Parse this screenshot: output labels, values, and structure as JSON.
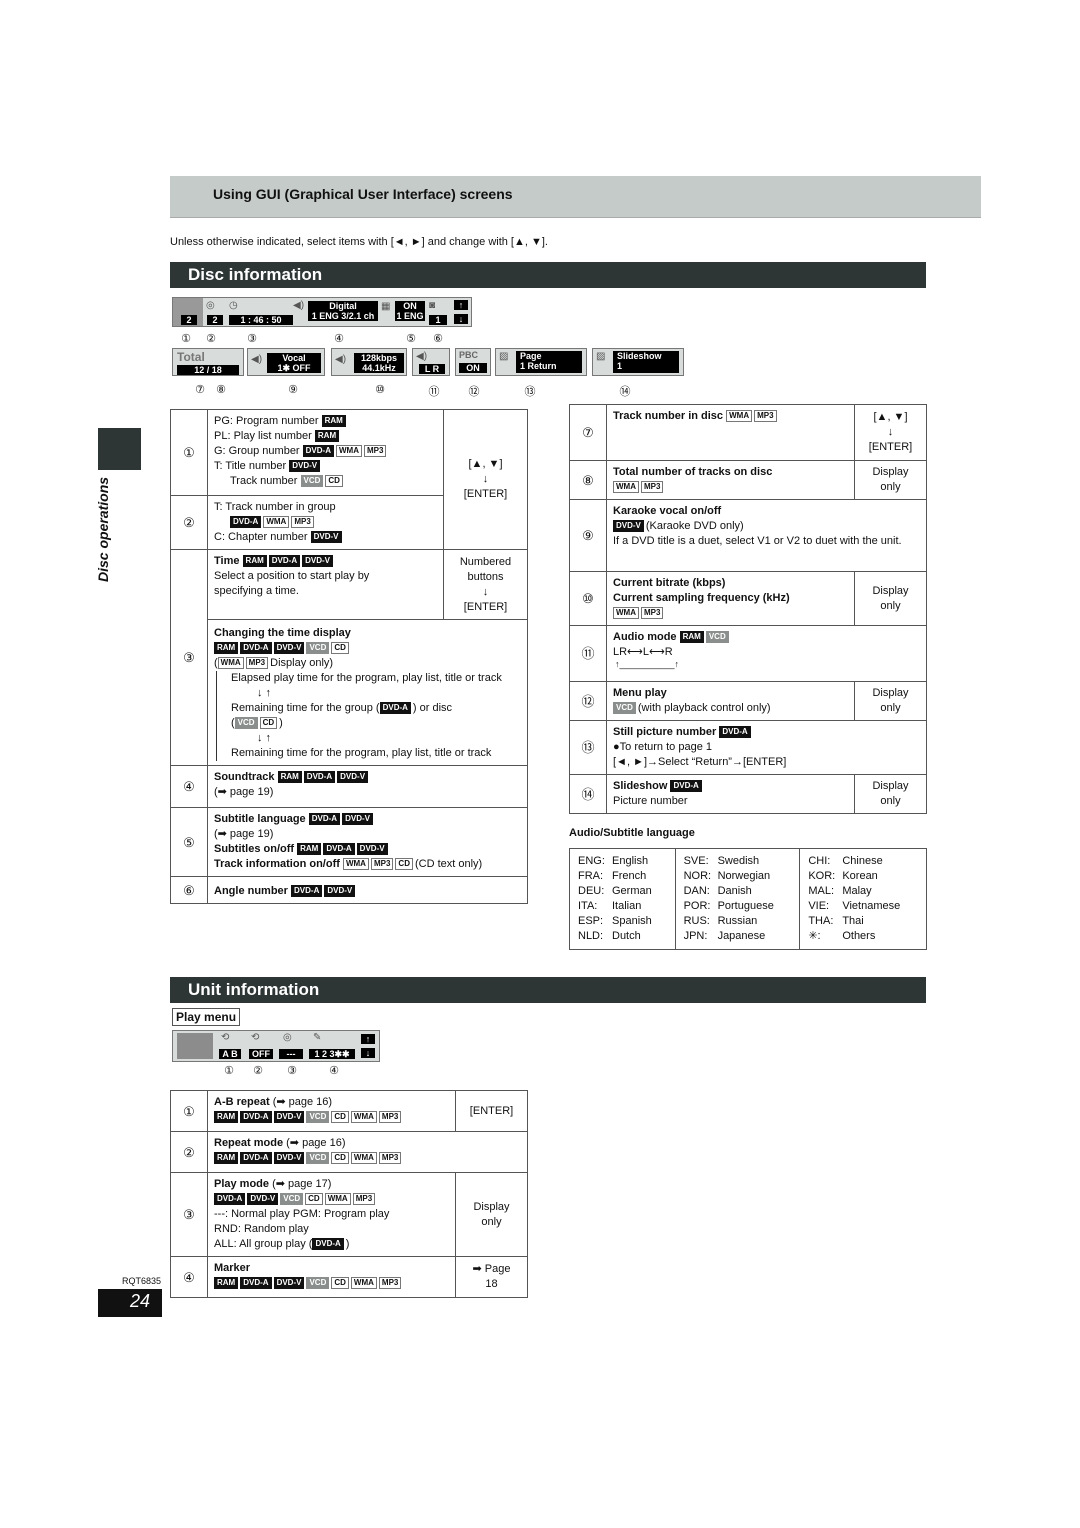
{
  "gui_header": "Using GUI (Graphical User Interface) screens",
  "intro": "Unless otherwise indicated, select items with [◄, ►] and change with [▲, ▼].",
  "side_label": "Disc operations",
  "disc_info": {
    "title": "Disc information",
    "osd_row1": {
      "program_number": "2",
      "group_number": "2",
      "time": "1 : 46 : 50",
      "audio_line1": "Digital",
      "audio_line2": "1 ENG 3/2.1 ch",
      "subtitle_line1": "ON",
      "subtitle_line2": "1 ENG",
      "angle": "1",
      "callouts": [
        "①",
        "②",
        "③",
        "④",
        "⑤",
        "⑥"
      ]
    },
    "osd_row2": {
      "total_label": "Total",
      "total_value": "12 / 18",
      "vocal_line1": "Vocal",
      "vocal_line2": "1✱   OFF",
      "bitrate_line1": "128kbps",
      "bitrate_line2": "44.1kHz",
      "audio_mode": "L R",
      "pbc_label": "PBC",
      "pbc_value": "ON",
      "page_line1": "Page",
      "page_line2": "1  Return",
      "slideshow_line1": "Slideshow",
      "slideshow_line2": "1",
      "callouts": [
        "⑦",
        "⑧",
        "⑨",
        "⑩",
        "⑪",
        "⑫",
        "⑬",
        "⑭"
      ]
    },
    "left_table": {
      "r1": {
        "n": "①",
        "pg": "PG:  Program number",
        "pl": "PL:  Play list number",
        "g": "G:  Group number",
        "t": "T:  Title number",
        "track": "Track number"
      },
      "r12_action": [
        "[▲, ▼]",
        "↓",
        "[ENTER]"
      ],
      "r2": {
        "n": "②",
        "t": "T:  Track number in group",
        "c": "C:  Chapter number"
      },
      "r3a": {
        "n": "③",
        "title": "Time",
        "desc": "Select a position to start play by specifying a time.",
        "action": [
          "Numbered",
          "buttons",
          "↓",
          "[ENTER]"
        ]
      },
      "r3b": {
        "title": "Changing the time display",
        "display_only": "Display only)",
        "l1": "Elapsed play time for the program, play list, title or track",
        "arrows": "↓ ↑",
        "l2a": "Remaining time for the group (",
        "l2b": ") or disc",
        "l3": "Remaining time for the program, play list, title or track"
      },
      "r4": {
        "n": "④",
        "title": "Soundtrack",
        "ref": "(➡ page 19)"
      },
      "r5": {
        "n": "⑤",
        "title1": "Subtitle language",
        "ref": "(➡ page 19)",
        "title2": "Subtitles on/off",
        "title3": "Track information on/off",
        "note": "(CD text only)"
      },
      "r6": {
        "n": "⑥",
        "title": "Angle number"
      }
    },
    "right_table": {
      "r7": {
        "n": "⑦",
        "title": "Track number in disc",
        "action": [
          "[▲, ▼]",
          "↓",
          "[ENTER]"
        ]
      },
      "r8": {
        "n": "⑧",
        "title": "Total number of tracks on disc",
        "action": [
          "Display",
          "only"
        ]
      },
      "r9": {
        "n": "⑨",
        "title": "Karaoke vocal on/off",
        "note": "(Karaoke DVD only)",
        "desc": "If a DVD title is a duet, select V1 or V2 to duet with the unit."
      },
      "r10": {
        "n": "⑩",
        "title1": "Current bitrate (kbps)",
        "title2": "Current sampling frequency (kHz)",
        "action": [
          "Display",
          "only"
        ]
      },
      "r11": {
        "n": "⑪",
        "title": "Audio mode",
        "flow": "LR⟷L⟷R",
        "loop": "↑___________↑"
      },
      "r12": {
        "n": "⑫",
        "title": "Menu play",
        "note": "(with playback control only)",
        "action": [
          "Display",
          "only"
        ]
      },
      "r13": {
        "n": "⑬",
        "title": "Still picture number",
        "bullet": "●To return to page 1",
        "instr": "[◄, ►]→Select “Return”→[ENTER]"
      },
      "r14": {
        "n": "⑭",
        "title": "Slideshow",
        "desc": "Picture number",
        "action": [
          "Display",
          "only"
        ]
      }
    },
    "lang_title": "Audio/Subtitle language",
    "languages": [
      [
        [
          "ENG:",
          "English"
        ],
        [
          "FRA:",
          "French"
        ],
        [
          "DEU:",
          "German"
        ],
        [
          "ITA:",
          "Italian"
        ],
        [
          "ESP:",
          "Spanish"
        ],
        [
          "NLD:",
          "Dutch"
        ]
      ],
      [
        [
          "SVE:",
          "Swedish"
        ],
        [
          "NOR:",
          "Norwegian"
        ],
        [
          "DAN:",
          "Danish"
        ],
        [
          "POR:",
          "Portuguese"
        ],
        [
          "RUS:",
          "Russian"
        ],
        [
          "JPN:",
          "Japanese"
        ]
      ],
      [
        [
          "CHI:",
          "Chinese"
        ],
        [
          "KOR:",
          "Korean"
        ],
        [
          "MAL:",
          "Malay"
        ],
        [
          "VIE:",
          "Vietnamese"
        ],
        [
          "THA:",
          "Thai"
        ],
        [
          "✳:",
          "Others"
        ]
      ]
    ]
  },
  "unit_info": {
    "title": "Unit information",
    "play_menu_label": "Play menu",
    "osd": {
      "ab": "A B",
      "repeat": "OFF",
      "play_mode": "---",
      "marker": "1 2 3✱✱",
      "callouts": [
        "①",
        "②",
        "③",
        "④"
      ]
    },
    "table": {
      "r1": {
        "n": "①",
        "title": "A-B repeat",
        "ref": "(➡ page 16)",
        "action": "[ENTER]"
      },
      "r2": {
        "n": "②",
        "title": "Repeat mode",
        "ref": "(➡ page 16)"
      },
      "r3": {
        "n": "③",
        "title": "Play mode",
        "ref": "(➡ page 17)",
        "l1": "---:  Normal play  PGM:  Program play",
        "l2": "RND:  Random play",
        "l3": "ALL:  All group play (",
        "action": [
          "Display",
          "only"
        ]
      },
      "r4": {
        "n": "④",
        "title": "Marker",
        "action": [
          "➡ Page",
          "18"
        ]
      }
    }
  },
  "tags": {
    "ram": "RAM",
    "dvda": "DVD-A",
    "dvdv": "DVD-V",
    "vcd": "VCD",
    "cd": "CD",
    "wma": "WMA",
    "mp3": "MP3"
  },
  "footer": {
    "code": "RQT6835",
    "page": "24"
  }
}
